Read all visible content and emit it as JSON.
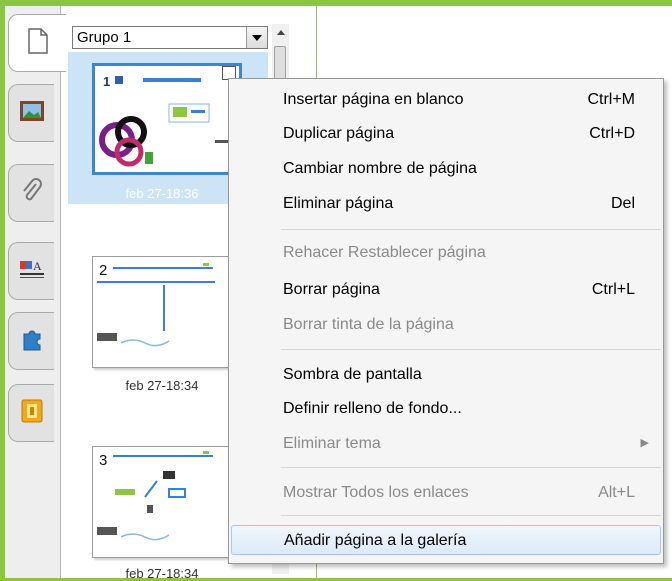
{
  "sorter": {
    "group_label": "Grupo 1",
    "pages": [
      {
        "number": "1",
        "caption": "feb 27-18:36",
        "selected": true
      },
      {
        "number": "2",
        "caption": "feb 27-18:34",
        "selected": false
      },
      {
        "number": "3",
        "caption": "feb 27-18:34",
        "selected": false
      }
    ]
  },
  "tabs": [
    {
      "icon": "page-sorter-icon",
      "active": true
    },
    {
      "icon": "gallery-icon",
      "active": false
    },
    {
      "icon": "attachments-icon",
      "active": false
    },
    {
      "icon": "properties-icon",
      "active": false
    },
    {
      "icon": "addons-icon",
      "active": false
    },
    {
      "icon": "lesson-activity-icon",
      "active": false
    }
  ],
  "menu": {
    "items": [
      {
        "label": "Insertar página en blanco",
        "shortcut": "Ctrl+M",
        "enabled": true
      },
      {
        "label": "Duplicar página",
        "shortcut": "Ctrl+D",
        "enabled": true
      },
      {
        "label": "Cambiar nombre de página",
        "shortcut": "",
        "enabled": true
      },
      {
        "label": "Eliminar página",
        "shortcut": "Del",
        "enabled": true
      },
      {
        "label": "Rehacer Restablecer página",
        "shortcut": "",
        "enabled": false
      },
      {
        "label": "Borrar página",
        "shortcut": "Ctrl+L",
        "enabled": true
      },
      {
        "label": "Borrar tinta de la página",
        "shortcut": "",
        "enabled": false
      },
      {
        "label": "Sombra de pantalla",
        "shortcut": "",
        "enabled": true
      },
      {
        "label": "Definir relleno de fondo...",
        "shortcut": "",
        "enabled": true
      },
      {
        "label": "Eliminar tema",
        "shortcut": "",
        "enabled": false,
        "submenu": true
      },
      {
        "label": "Mostrar Todos los enlaces",
        "shortcut": "Alt+L",
        "enabled": false
      },
      {
        "label": "Añadir página a la galería",
        "shortcut": "",
        "enabled": true,
        "highlighted": true
      }
    ]
  },
  "colors": {
    "frame": "#8cc63f",
    "selection": "#cde4f7",
    "selection_border": "#3a86d4",
    "disabled_text": "#8a8a8a"
  }
}
